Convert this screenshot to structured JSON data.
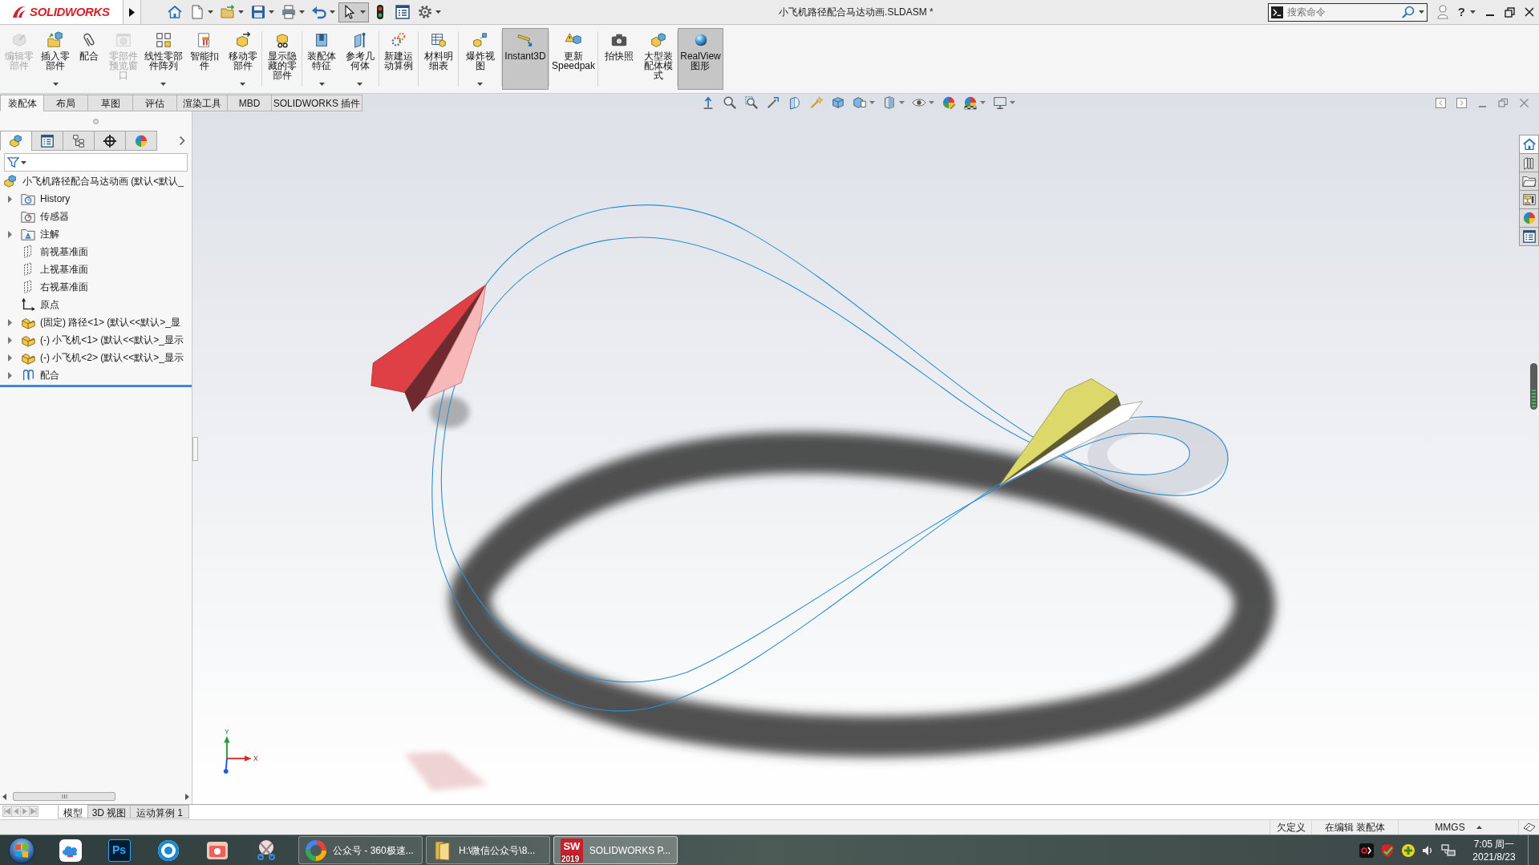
{
  "title_bar": {
    "logo": "SOLIDWORKS",
    "quick_access": [
      {
        "dropdown": false,
        "selected": false
      },
      {
        "dropdown": true,
        "selected": false
      },
      {
        "dropdown": true,
        "selected": false
      },
      {
        "dropdown": true,
        "selected": false
      },
      {
        "dropdown": true,
        "selected": false
      },
      {
        "dropdown": true,
        "selected": false
      },
      {
        "dropdown": true,
        "selected": true
      },
      {
        "dropdown": false,
        "selected": false
      },
      {
        "dropdown": false,
        "selected": false
      },
      {
        "dropdown": true,
        "selected": false
      }
    ],
    "title": "小飞机路径配合马达动画.SLDASM *",
    "search": {
      "placeholder": "搜索命令"
    },
    "help": "?"
  },
  "ribbon": {
    "buttons": [
      {
        "label": "编辑零部件",
        "disabled": true,
        "selected": false,
        "dropdown": false
      },
      {
        "label": "插入零部件",
        "disabled": false,
        "selected": false,
        "dropdown": true
      },
      {
        "label": "配合",
        "disabled": false,
        "selected": false,
        "dropdown": false
      },
      {
        "label": "零部件预览窗口",
        "disabled": true,
        "selected": false,
        "dropdown": false
      },
      {
        "label": "线性零部件阵列",
        "disabled": false,
        "selected": false,
        "dropdown": true
      },
      {
        "label": "智能扣件",
        "disabled": false,
        "selected": false,
        "dropdown": false
      },
      {
        "label": "移动零部件",
        "disabled": false,
        "selected": false,
        "dropdown": true
      },
      {
        "label": "显示隐藏的零部件",
        "disabled": false,
        "selected": false,
        "dropdown": false
      },
      {
        "label": "装配体特征",
        "disabled": false,
        "selected": false,
        "dropdown": true
      },
      {
        "label": "参考几何体",
        "disabled": false,
        "selected": false,
        "dropdown": true
      },
      {
        "label": "新建运动算例",
        "disabled": false,
        "selected": false,
        "dropdown": false
      },
      {
        "label": "材料明细表",
        "disabled": false,
        "selected": false,
        "dropdown": false
      },
      {
        "label": "爆炸视图",
        "disabled": false,
        "selected": false,
        "dropdown": true
      },
      {
        "label": "Instant3D",
        "disabled": false,
        "selected": true,
        "dropdown": false
      },
      {
        "label": "更新 Speedpak",
        "disabled": false,
        "selected": false,
        "dropdown": false
      },
      {
        "label": "拍快照",
        "disabled": false,
        "selected": false,
        "dropdown": false
      },
      {
        "label": "大型装配体模式",
        "disabled": false,
        "selected": false,
        "dropdown": false
      },
      {
        "label": "RealView 图形",
        "disabled": false,
        "selected": true,
        "dropdown": false
      }
    ]
  },
  "command_tabs": [
    {
      "label": "装配体",
      "selected": true
    },
    {
      "label": "布局",
      "selected": false
    },
    {
      "label": "草图",
      "selected": false
    },
    {
      "label": "评估",
      "selected": false
    },
    {
      "label": "渲染工具",
      "selected": false
    },
    {
      "label": "MBD",
      "selected": false
    },
    {
      "label": "SOLIDWORKS 插件",
      "selected": false
    }
  ],
  "view_toolbar": [
    {
      "dropdown": false
    },
    {
      "dropdown": false
    },
    {
      "dropdown": false
    },
    {
      "dropdown": false
    },
    {
      "dropdown": false
    },
    {
      "dropdown": false
    },
    {
      "dropdown": false
    },
    {
      "dropdown": true
    },
    {
      "dropdown": true
    },
    {
      "dropdown": true
    },
    {
      "dropdown": false
    },
    {
      "dropdown": true
    },
    {
      "dropdown": true
    }
  ],
  "feature_manager": {
    "tabs": [
      {
        "selected": true
      },
      {
        "selected": false
      },
      {
        "selected": false
      },
      {
        "selected": false
      },
      {
        "selected": false
      }
    ],
    "tree": [
      {
        "label": "小飞机路径配合马达动画 (默认<默认_",
        "kind": "assembly",
        "children": [
          {
            "label": "History",
            "kind": "history",
            "expanded": false
          },
          {
            "label": "传感器",
            "kind": "sensors"
          },
          {
            "label": "注解",
            "kind": "annotations",
            "expanded": false
          },
          {
            "label": "前视基准面",
            "kind": "plane"
          },
          {
            "label": "上视基准面",
            "kind": "plane"
          },
          {
            "label": "右视基准面",
            "kind": "plane"
          },
          {
            "label": "原点",
            "kind": "origin"
          },
          {
            "label": "(固定) 路径<1> (默认<<默认>_显",
            "kind": "part",
            "expanded": false
          },
          {
            "label": "(-) 小飞机<1> (默认<<默认>_显示",
            "kind": "part",
            "expanded": false
          },
          {
            "label": "(-) 小飞机<2> (默认<<默认>_显示",
            "kind": "part",
            "expanded": false
          },
          {
            "label": "配合",
            "kind": "mates",
            "expanded": false
          }
        ]
      }
    ]
  },
  "triad": {
    "y": "Y",
    "x": "X"
  },
  "task_pane": [
    {
      "selected": true
    },
    {
      "selected": false
    },
    {
      "selected": false
    },
    {
      "selected": false
    },
    {
      "selected": false
    },
    {
      "selected": false
    }
  ],
  "bottom_tabs": [
    {
      "label": "模型",
      "selected": true
    },
    {
      "label": "3D 视图",
      "selected": false
    },
    {
      "label": "运动算例 1",
      "selected": false
    }
  ],
  "status_bar": [
    "欠定义",
    "在编辑 装配体",
    "MMGS"
  ],
  "taskbar": {
    "pinned": [
      {
        "kind": "cloud"
      },
      {
        "kind": "letters",
        "text": "Ps"
      },
      {
        "kind": "aperture"
      },
      {
        "kind": "photo"
      },
      {
        "kind": "scissors"
      }
    ],
    "tasks": [
      {
        "label": "公众号 - 360极速...",
        "kind": "browser",
        "selected": false
      },
      {
        "label": "H:\\微信公众号\\8...",
        "kind": "folder",
        "selected": false
      },
      {
        "label": "SOLIDWORKS P...",
        "kind": "app",
        "icon_text": "SW",
        "badge": "2019",
        "selected": true
      }
    ],
    "time": "7:05 周一",
    "date": "2021/8/23"
  }
}
